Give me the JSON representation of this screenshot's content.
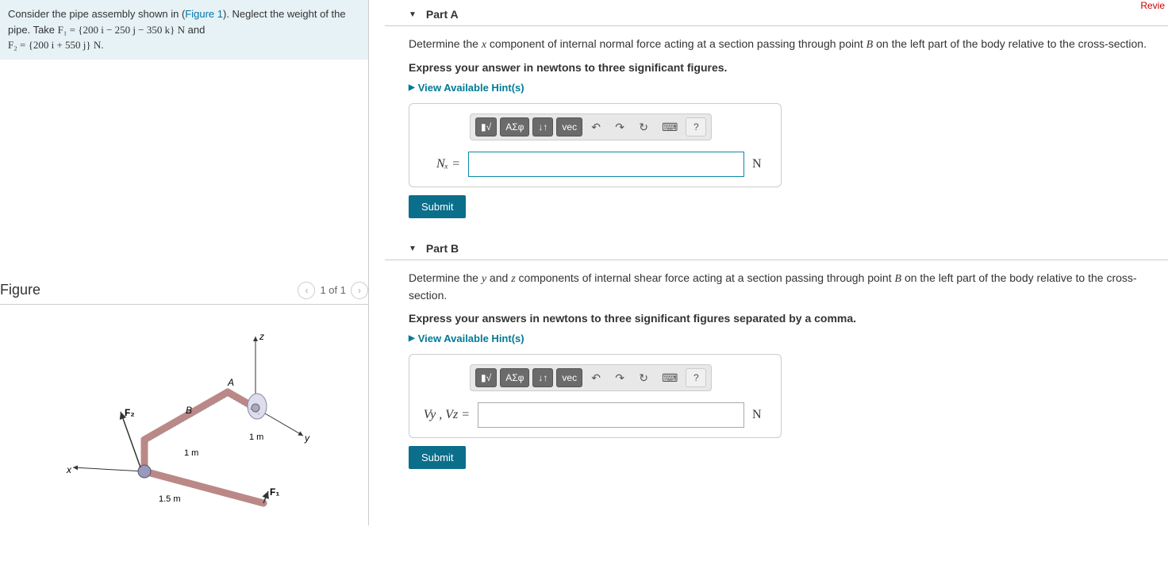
{
  "problem": {
    "line1_pre": "Consider the pipe assembly shown in (",
    "figure_link": "Figure 1",
    "line1_post": "). Neglect the weight of the pipe. Take ",
    "f1_expr": "F₁ = {200 i − 250 j − 350 k} N",
    "and": " and",
    "f2_expr": "F₂ = {200 i + 550 j} N."
  },
  "figure": {
    "title": "Figure",
    "counter": "1 of 1",
    "labels": {
      "z": "z",
      "y": "y",
      "x": "x",
      "A": "A",
      "B": "B",
      "F1": "F₁",
      "F2": "F₂",
      "d1": "1 m",
      "d2": "1 m",
      "d3": "1.5 m"
    }
  },
  "partA": {
    "title": "Part A",
    "prompt_pre": "Determine the ",
    "prompt_var": "x",
    "prompt_mid": " component of internal normal force acting at a section passing through point ",
    "prompt_pt": "B",
    "prompt_post": " on the left part of the body relative to the cross-section.",
    "instruct": "Express your answer in newtons to three significant figures.",
    "hints": "View Available Hint(s)",
    "var_label": "Nₓ =",
    "unit": "N",
    "submit": "Submit"
  },
  "partB": {
    "title": "Part B",
    "prompt_pre": "Determine the ",
    "prompt_var1": "y",
    "prompt_and": " and ",
    "prompt_var2": "z",
    "prompt_mid": " components of internal shear force acting at a section passing through point ",
    "prompt_pt": "B",
    "prompt_post": " on the left part of the body relative to the cross-section.",
    "instruct": "Express your answers in newtons to three significant figures separated by a comma.",
    "hints": "View Available Hint(s)",
    "var_label": "Vy , Vz =",
    "unit": "N",
    "submit": "Submit"
  },
  "toolbar": {
    "templates": "▮√",
    "greek": "ΑΣφ",
    "subsup": "↓↑",
    "vec": "vec",
    "undo": "↶",
    "redo": "↷",
    "reset": "↻",
    "keyboard": "⌨",
    "help": "?"
  },
  "top_right": "Revie"
}
